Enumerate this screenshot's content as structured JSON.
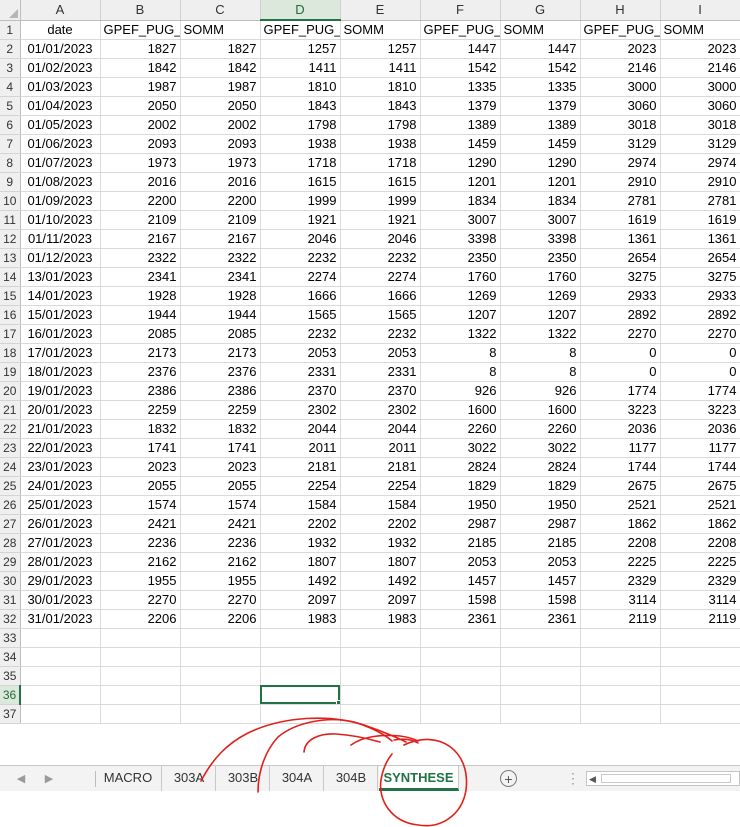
{
  "columns": [
    "A",
    "B",
    "C",
    "D",
    "E",
    "F",
    "G",
    "H",
    "I"
  ],
  "selected_column": "D",
  "selected_row": 36,
  "header_row": [
    "date",
    "GPEF_PUG_T",
    "SOMM",
    "GPEF_PUG_T",
    "SOMM",
    "GPEF_PUG_T",
    "SOMM",
    "GPEF_PUG_T",
    "SOMM"
  ],
  "data_rows": [
    [
      "01/01/2023",
      "1827",
      "1827",
      "1257",
      "1257",
      "1447",
      "1447",
      "2023",
      "2023"
    ],
    [
      "01/02/2023",
      "1842",
      "1842",
      "1411",
      "1411",
      "1542",
      "1542",
      "2146",
      "2146"
    ],
    [
      "01/03/2023",
      "1987",
      "1987",
      "1810",
      "1810",
      "1335",
      "1335",
      "3000",
      "3000"
    ],
    [
      "01/04/2023",
      "2050",
      "2050",
      "1843",
      "1843",
      "1379",
      "1379",
      "3060",
      "3060"
    ],
    [
      "01/05/2023",
      "2002",
      "2002",
      "1798",
      "1798",
      "1389",
      "1389",
      "3018",
      "3018"
    ],
    [
      "01/06/2023",
      "2093",
      "2093",
      "1938",
      "1938",
      "1459",
      "1459",
      "3129",
      "3129"
    ],
    [
      "01/07/2023",
      "1973",
      "1973",
      "1718",
      "1718",
      "1290",
      "1290",
      "2974",
      "2974"
    ],
    [
      "01/08/2023",
      "2016",
      "2016",
      "1615",
      "1615",
      "1201",
      "1201",
      "2910",
      "2910"
    ],
    [
      "01/09/2023",
      "2200",
      "2200",
      "1999",
      "1999",
      "1834",
      "1834",
      "2781",
      "2781"
    ],
    [
      "01/10/2023",
      "2109",
      "2109",
      "1921",
      "1921",
      "3007",
      "3007",
      "1619",
      "1619"
    ],
    [
      "01/11/2023",
      "2167",
      "2167",
      "2046",
      "2046",
      "3398",
      "3398",
      "1361",
      "1361"
    ],
    [
      "01/12/2023",
      "2322",
      "2322",
      "2232",
      "2232",
      "2350",
      "2350",
      "2654",
      "2654"
    ],
    [
      "13/01/2023",
      "2341",
      "2341",
      "2274",
      "2274",
      "1760",
      "1760",
      "3275",
      "3275"
    ],
    [
      "14/01/2023",
      "1928",
      "1928",
      "1666",
      "1666",
      "1269",
      "1269",
      "2933",
      "2933"
    ],
    [
      "15/01/2023",
      "1944",
      "1944",
      "1565",
      "1565",
      "1207",
      "1207",
      "2892",
      "2892"
    ],
    [
      "16/01/2023",
      "2085",
      "2085",
      "2232",
      "2232",
      "1322",
      "1322",
      "2270",
      "2270"
    ],
    [
      "17/01/2023",
      "2173",
      "2173",
      "2053",
      "2053",
      "8",
      "8",
      "0",
      "0"
    ],
    [
      "18/01/2023",
      "2376",
      "2376",
      "2331",
      "2331",
      "8",
      "8",
      "0",
      "0"
    ],
    [
      "19/01/2023",
      "2386",
      "2386",
      "2370",
      "2370",
      "926",
      "926",
      "1774",
      "1774"
    ],
    [
      "20/01/2023",
      "2259",
      "2259",
      "2302",
      "2302",
      "1600",
      "1600",
      "3223",
      "3223"
    ],
    [
      "21/01/2023",
      "1832",
      "1832",
      "2044",
      "2044",
      "2260",
      "2260",
      "2036",
      "2036"
    ],
    [
      "22/01/2023",
      "1741",
      "1741",
      "2011",
      "2011",
      "3022",
      "3022",
      "1177",
      "1177"
    ],
    [
      "23/01/2023",
      "2023",
      "2023",
      "2181",
      "2181",
      "2824",
      "2824",
      "1744",
      "1744"
    ],
    [
      "24/01/2023",
      "2055",
      "2055",
      "2254",
      "2254",
      "1829",
      "1829",
      "2675",
      "2675"
    ],
    [
      "25/01/2023",
      "1574",
      "1574",
      "1584",
      "1584",
      "1950",
      "1950",
      "2521",
      "2521"
    ],
    [
      "26/01/2023",
      "2421",
      "2421",
      "2202",
      "2202",
      "2987",
      "2987",
      "1862",
      "1862"
    ],
    [
      "27/01/2023",
      "2236",
      "2236",
      "1932",
      "1932",
      "2185",
      "2185",
      "2208",
      "2208"
    ],
    [
      "28/01/2023",
      "2162",
      "2162",
      "1807",
      "1807",
      "2053",
      "2053",
      "2225",
      "2225"
    ],
    [
      "29/01/2023",
      "1955",
      "1955",
      "1492",
      "1492",
      "1457",
      "1457",
      "2329",
      "2329"
    ],
    [
      "30/01/2023",
      "2270",
      "2270",
      "2097",
      "2097",
      "1598",
      "1598",
      "3114",
      "3114"
    ],
    [
      "31/01/2023",
      "2206",
      "2206",
      "1983",
      "1983",
      "2361",
      "2361",
      "2119",
      "2119"
    ]
  ],
  "empty_row_numbers": [
    33,
    34,
    35,
    36,
    37
  ],
  "tabs": [
    {
      "label": "MACRO",
      "active": false
    },
    {
      "label": "303A",
      "active": false
    },
    {
      "label": "303B",
      "active": false
    },
    {
      "label": "304A",
      "active": false
    },
    {
      "label": "304B",
      "active": false
    },
    {
      "label": "SYNTHESE",
      "active": true
    }
  ],
  "icons": {
    "prev_sheet": "caret-left-icon",
    "next_sheet": "caret-right-icon",
    "add_sheet": "plus-circle-icon",
    "more": "vertical-dots-icon",
    "scroll_left": "caret-left-icon"
  },
  "colors": {
    "accent": "#217346",
    "annotation": "#e0201b",
    "header_bg": "#efefef",
    "grid_line": "#d9d9d9"
  }
}
